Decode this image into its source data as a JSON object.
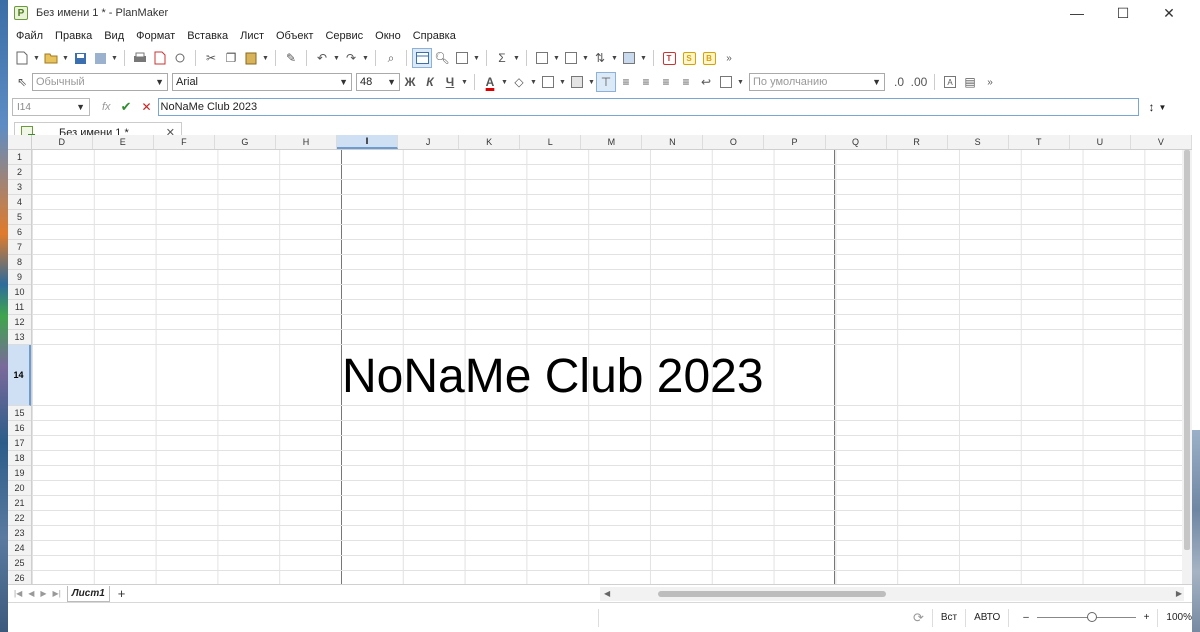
{
  "window": {
    "title": "Без имени 1 * - PlanMaker",
    "app_icon_letter": "P",
    "controls": [
      "—",
      "☐",
      "✕"
    ]
  },
  "menu": [
    "Файл",
    "Правка",
    "Вид",
    "Формат",
    "Вставка",
    "Лист",
    "Объект",
    "Сервис",
    "Окно",
    "Справка"
  ],
  "format_toolbar": {
    "style_value": "Обычный",
    "font_value": "Arial",
    "size_value": "48",
    "bold": "Ж",
    "italic": "К",
    "underline": "Ч",
    "font_color_glyph": "A",
    "number_format_value": "По умолчанию",
    "styles_tags": [
      "T",
      "S",
      "B"
    ]
  },
  "formula_bar": {
    "cell_ref": "I14",
    "fx": "fx",
    "content": "NoNaMe Club 2023"
  },
  "doc_tab": {
    "label": "Без имени 1 *",
    "close": "✕"
  },
  "grid": {
    "columns": [
      "D",
      "E",
      "F",
      "G",
      "H",
      "I",
      "J",
      "K",
      "L",
      "M",
      "N",
      "O",
      "P",
      "Q",
      "R",
      "S",
      "T",
      "U",
      "V"
    ],
    "selected_column": "I",
    "rows": [
      "1",
      "2",
      "3",
      "4",
      "5",
      "6",
      "7",
      "8",
      "9",
      "10",
      "11",
      "12",
      "13",
      "14",
      "15",
      "16",
      "17",
      "18",
      "19",
      "20",
      "21",
      "22",
      "23",
      "24",
      "25",
      "26"
    ],
    "selected_row": "14",
    "cell_text": "NoNaMe Club 2023"
  },
  "sheet_tabs": {
    "active": "Лист1",
    "add": "+"
  },
  "status_bar": {
    "mode": "Вст",
    "calc": "АВТО",
    "zoom_minus": "–",
    "zoom_plus": "+",
    "zoom": "100%",
    "zoom_level_percent": 100
  }
}
